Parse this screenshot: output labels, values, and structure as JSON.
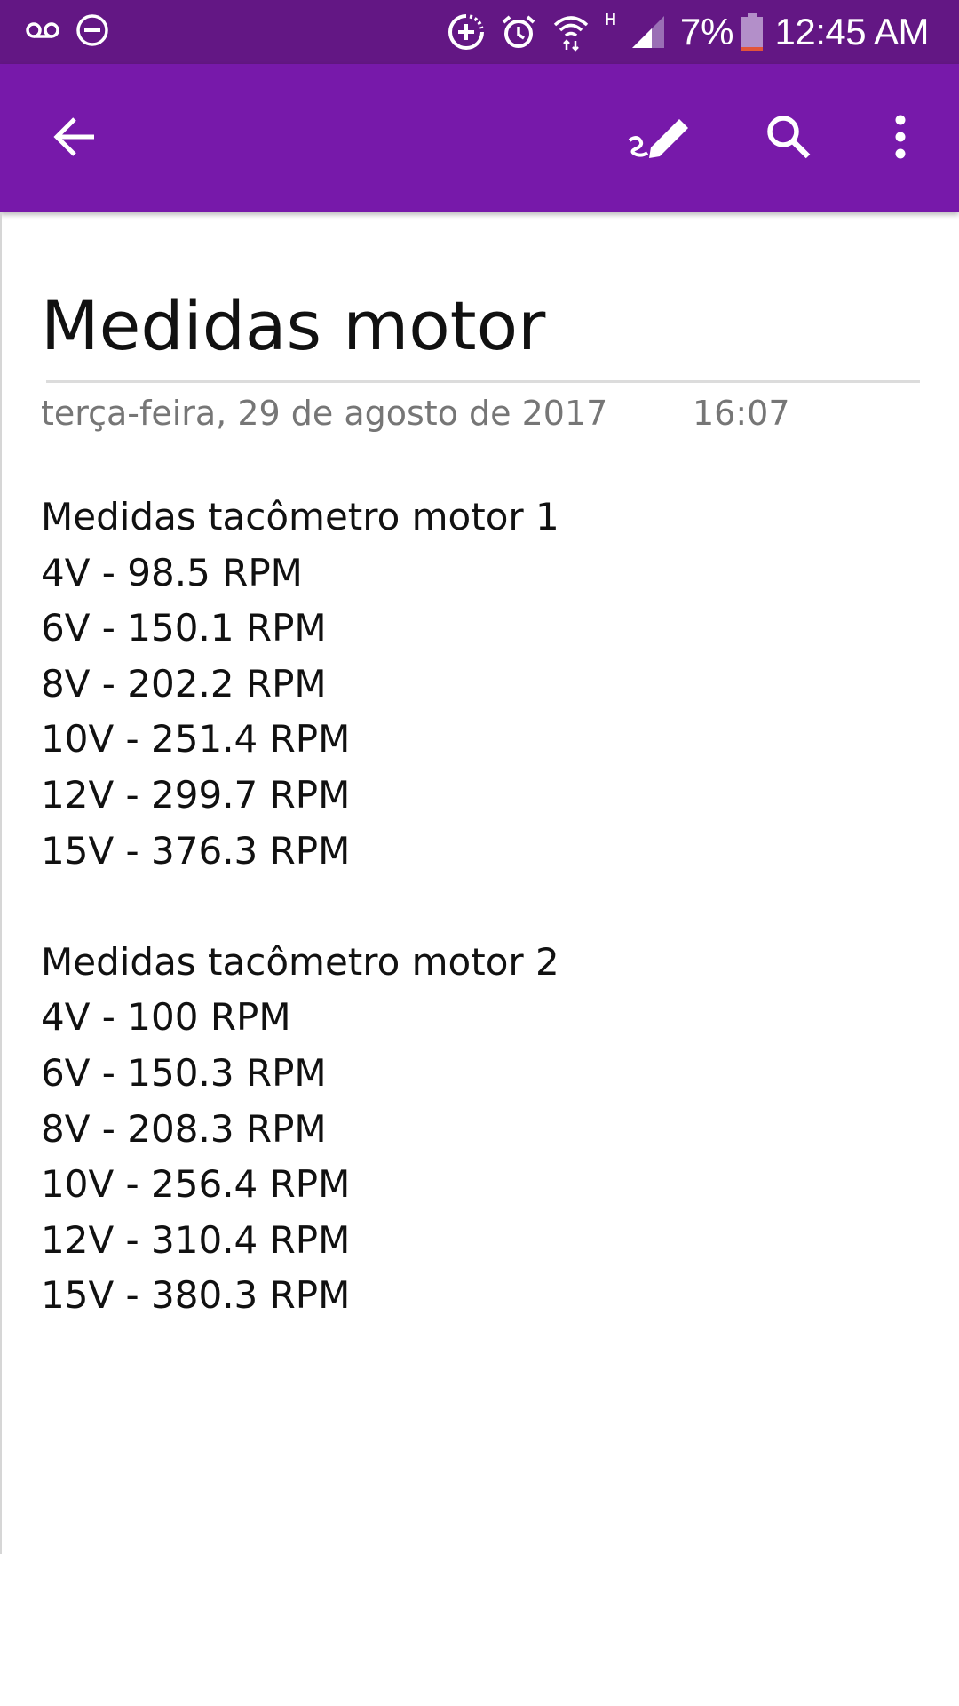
{
  "status_bar": {
    "icons": [
      "voicemail-icon",
      "do-not-disturb-icon",
      "data-saver-icon",
      "alarm-icon",
      "wifi-icon",
      "hspa-h-icon",
      "cell-signal-icon",
      "battery-icon"
    ],
    "network_type": "H",
    "battery_percent": "7%",
    "time": "12:45 AM",
    "background_color": "#631784"
  },
  "app_bar": {
    "background_color": "#7719aa",
    "actions": [
      "back-arrow-icon",
      "draw-pen-icon",
      "search-icon",
      "more-vertical-icon"
    ]
  },
  "page": {
    "title": "Medidas motor",
    "date": "terça-feira, 29 de agosto de 2017",
    "time": "16:07",
    "sections": [
      {
        "heading": "Medidas tacômetro motor 1",
        "lines": [
          "4V - 98.5 RPM",
          "6V - 150.1 RPM",
          "8V - 202.2 RPM",
          "10V - 251.4 RPM",
          "12V - 299.7 RPM",
          "15V - 376.3 RPM"
        ]
      },
      {
        "heading": "Medidas tacômetro motor 2",
        "lines": [
          "4V - 100 RPM",
          "6V - 150.3 RPM",
          "8V - 208.3 RPM",
          "10V - 256.4 RPM",
          "12V - 310.4 RPM",
          "15V - 380.3 RPM"
        ]
      }
    ]
  }
}
